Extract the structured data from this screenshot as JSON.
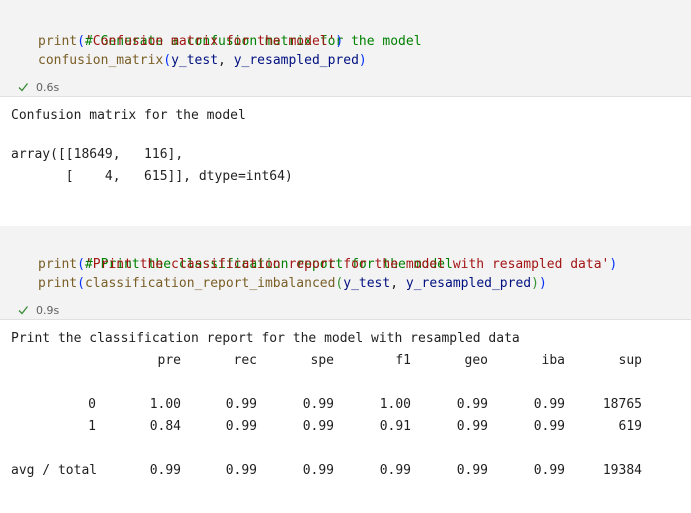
{
  "cell1": {
    "comment": "# Generate a confusion matrix for the model",
    "line2_func": "print",
    "line2_str": "'Confusion matrix for the model'",
    "line3_func": "confusion_matrix",
    "line3_arg1": "y_test",
    "line3_arg2": "y_resampled_pred",
    "exec_time": "0.6s"
  },
  "output1": {
    "title": "Confusion matrix for the model",
    "array_line1": "array([[18649,   116],",
    "array_line2": "       [    4,   615]], dtype=int64)"
  },
  "cell2": {
    "comment": "# Print the classification report for the model",
    "line2_func": "print",
    "line2_str": "'Print the classification report for the model with resampled data'",
    "line3_func1": "print",
    "line3_func2": "classification_report_imbalanced",
    "line3_arg1": "y_test",
    "line3_arg2": "y_resampled_pred",
    "exec_time": "0.9s"
  },
  "output2": {
    "title": "Print the classification report for the model with resampled data",
    "headers": [
      "pre",
      "rec",
      "spe",
      "f1",
      "geo",
      "iba",
      "sup"
    ],
    "rows": [
      {
        "label": "0",
        "values": [
          "1.00",
          "0.99",
          "0.99",
          "1.00",
          "0.99",
          "0.99",
          "18765"
        ]
      },
      {
        "label": "1",
        "values": [
          "0.84",
          "0.99",
          "0.99",
          "0.91",
          "0.99",
          "0.99",
          "619"
        ]
      },
      {
        "label": "avg / total",
        "values": [
          "0.99",
          "0.99",
          "0.99",
          "0.99",
          "0.99",
          "0.99",
          "19384"
        ]
      }
    ]
  },
  "colors": {
    "comment": "#008000",
    "function": "#795e26",
    "string": "#a31515",
    "variable": "#001080",
    "success_check": "#388a34"
  }
}
